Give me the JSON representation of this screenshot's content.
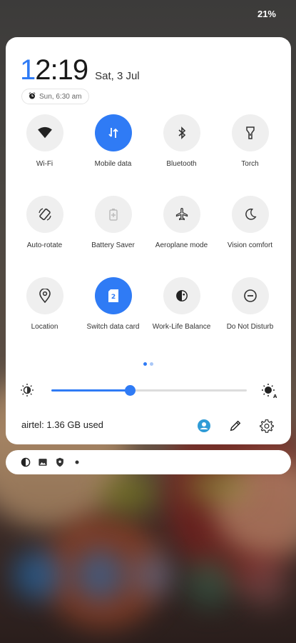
{
  "status_bar": {
    "battery": "21%"
  },
  "header": {
    "time": "12:19",
    "time_first_char": "1",
    "time_rest": "2:19",
    "date": "Sat, 3 Jul",
    "alarm": "Sun, 6:30 am"
  },
  "tiles": [
    {
      "label": "Wi-Fi",
      "icon": "wifi-icon",
      "active": false
    },
    {
      "label": "Mobile data",
      "icon": "mobile-data-icon",
      "active": true
    },
    {
      "label": "Bluetooth",
      "icon": "bluetooth-icon",
      "active": false
    },
    {
      "label": "Torch",
      "icon": "torch-icon",
      "active": false
    },
    {
      "label": "Auto-rotate",
      "icon": "auto-rotate-icon",
      "active": false
    },
    {
      "label": "Battery Saver",
      "icon": "battery-saver-icon",
      "active": false
    },
    {
      "label": "Aeroplane mode",
      "icon": "aeroplane-icon",
      "active": false
    },
    {
      "label": "Vision comfort",
      "icon": "moon-icon",
      "active": false
    },
    {
      "label": "Location",
      "icon": "location-icon",
      "active": false
    },
    {
      "label": "Switch data card",
      "icon": "sim-card-icon",
      "active": true,
      "badge": "2"
    },
    {
      "label": "Work-Life Balance",
      "icon": "work-life-icon",
      "active": false
    },
    {
      "label": "Do Not Disturb",
      "icon": "do-not-disturb-icon",
      "active": false
    }
  ],
  "brightness": {
    "level": 0.4
  },
  "footer": {
    "data_usage": "airtel: 1.36 GB used"
  },
  "colors": {
    "accent": "#2f7bf5",
    "tile_bg": "#efefef",
    "panel_bg": "#ffffff"
  }
}
